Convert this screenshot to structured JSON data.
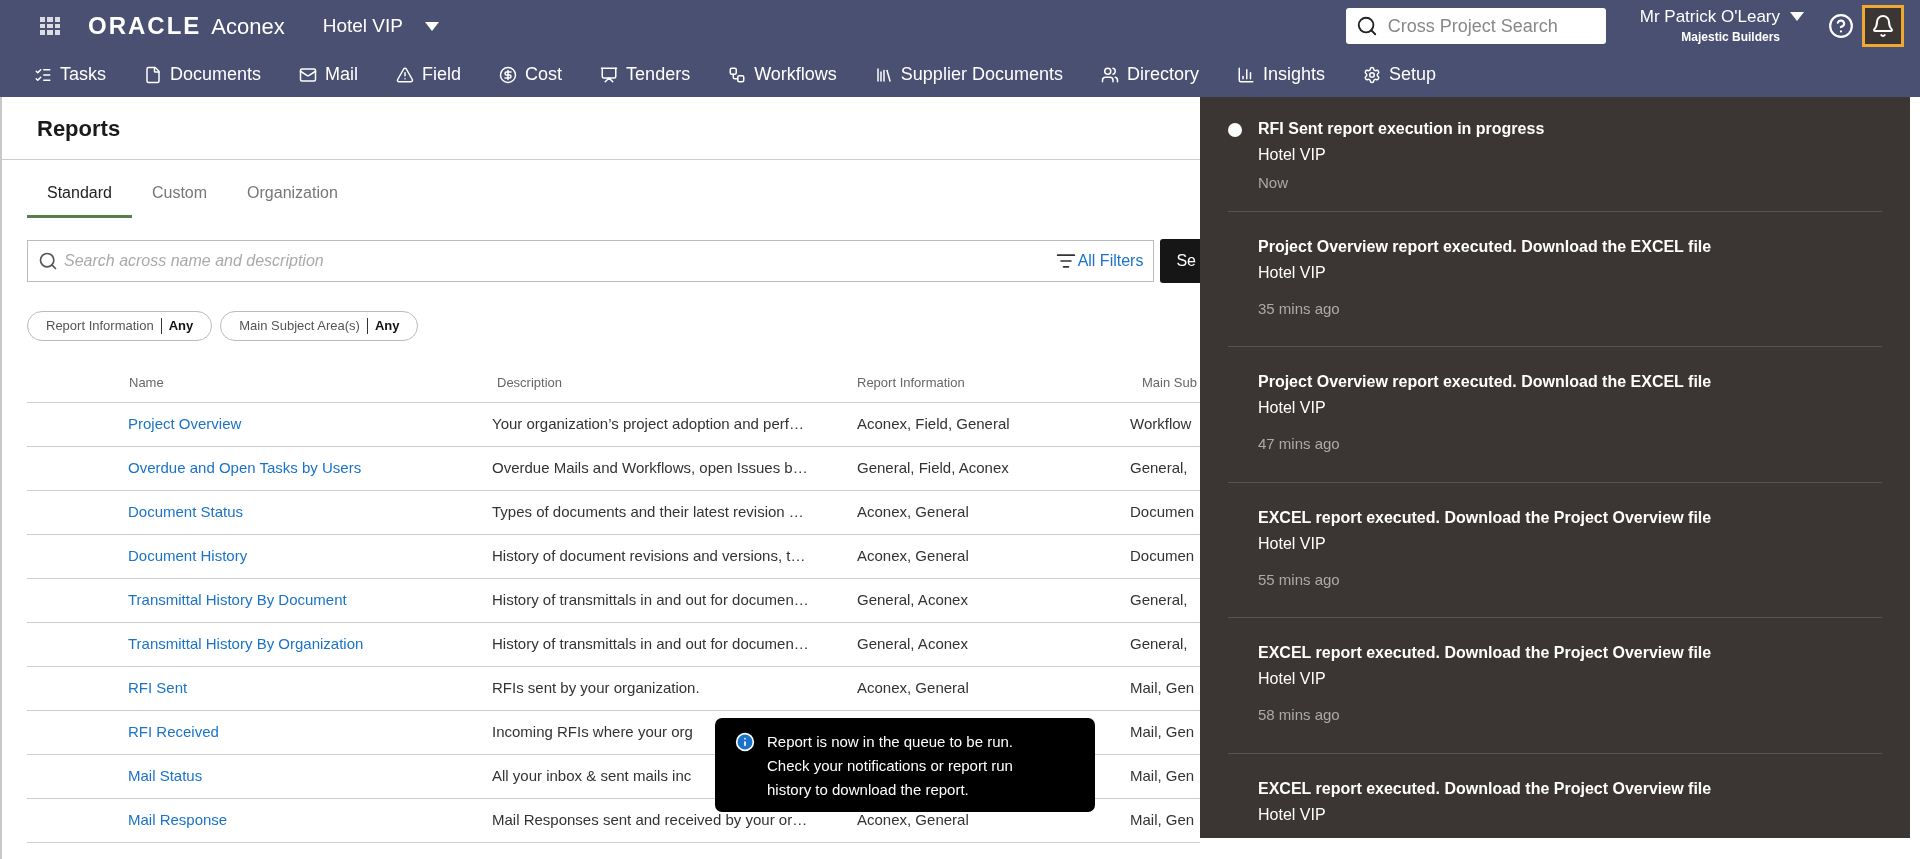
{
  "header": {
    "logo_brand": "ORACLE",
    "logo_product": "Aconex",
    "project": "Hotel VIP",
    "search": {
      "placeholder": "Cross Project Search"
    },
    "user": {
      "name": "Mr Patrick O'Leary",
      "company": "Majestic Builders"
    },
    "notifications_button": {
      "active": true
    }
  },
  "nav": [
    {
      "label": "Tasks"
    },
    {
      "label": "Documents"
    },
    {
      "label": "Mail"
    },
    {
      "label": "Field"
    },
    {
      "label": "Cost"
    },
    {
      "label": "Tenders"
    },
    {
      "label": "Workflows"
    },
    {
      "label": "Supplier Documents"
    },
    {
      "label": "Directory"
    },
    {
      "label": "Insights"
    },
    {
      "label": "Setup"
    }
  ],
  "page_title": "Reports",
  "tabs": [
    {
      "label": "Standard",
      "selected": true
    },
    {
      "label": "Custom",
      "selected": false
    },
    {
      "label": "Organization",
      "selected": false
    }
  ],
  "search": {
    "placeholder": "Search across name and description",
    "filters_link": "All Filters",
    "button": "Se"
  },
  "chips": [
    {
      "label": "Report Information",
      "value": "Any"
    },
    {
      "label": "Main Subject Area(s)",
      "value": "Any"
    }
  ],
  "table": {
    "columns": [
      "Name",
      "Description",
      "Report Information",
      "Main Sub"
    ],
    "rows": [
      {
        "name": "Project Overview",
        "description": "Your organization’s project adoption and perf…",
        "info": "Aconex, Field, General",
        "column_4": "Workflow"
      },
      {
        "name": "Overdue and Open Tasks by Users",
        "description": "Overdue Mails and Workflows, open Issues b…",
        "info": "General, Field, Aconex",
        "column_4": "General,"
      },
      {
        "name": "Document Status",
        "description": "Types of documents and their latest revision …",
        "info": "Aconex, General",
        "column_4": "Documen"
      },
      {
        "name": "Document History",
        "description": "History of document revisions and versions, t…",
        "info": "Aconex, General",
        "column_4": "Documen"
      },
      {
        "name": "Transmittal History By Document",
        "description": "History of transmittals in and out for documen…",
        "info": "General, Aconex",
        "column_4": "General,"
      },
      {
        "name": "Transmittal History By Organization",
        "description": "History of transmittals in and out for documen…",
        "info": "General, Aconex",
        "column_4": "General,"
      },
      {
        "name": "RFI Sent",
        "description": "RFIs sent by your organization.",
        "info": "Aconex, General",
        "column_4": "Mail, Gen"
      },
      {
        "name": "RFI Received",
        "description": "Incoming RFIs where your org",
        "info": "",
        "column_4": "Mail, Gen"
      },
      {
        "name": "Mail Status",
        "description": "All your inbox & sent mails inc",
        "info": "",
        "column_4": "Mail, Gen"
      },
      {
        "name": "Mail Response",
        "description": "Mail Responses sent and received by your or…",
        "info": "Aconex, General",
        "column_4": "Mail, Gen"
      }
    ]
  },
  "toast": {
    "lines": [
      "Report is now in the queue to be run.",
      "Check your notifications or report run",
      "history to download the report."
    ]
  },
  "notifications": [
    {
      "title": "RFI Sent report execution in progress",
      "project": "Hotel VIP",
      "time": "Now",
      "unread": true
    },
    {
      "title": "Project Overview report executed. Download the EXCEL file",
      "project": "Hotel VIP",
      "time": "35 mins ago",
      "unread": false
    },
    {
      "title": "Project Overview report executed. Download the EXCEL file",
      "project": "Hotel VIP",
      "time": "47 mins ago",
      "unread": false
    },
    {
      "title": "EXCEL report executed. Download the Project Overview file",
      "project": "Hotel VIP",
      "time": "55 mins ago",
      "unread": false
    },
    {
      "title": "EXCEL report executed. Download the Project Overview file",
      "project": "Hotel VIP",
      "time": "58 mins ago",
      "unread": false
    },
    {
      "title": "EXCEL report executed. Download the Project Overview file",
      "project": "Hotel VIP",
      "unread": false
    }
  ]
}
